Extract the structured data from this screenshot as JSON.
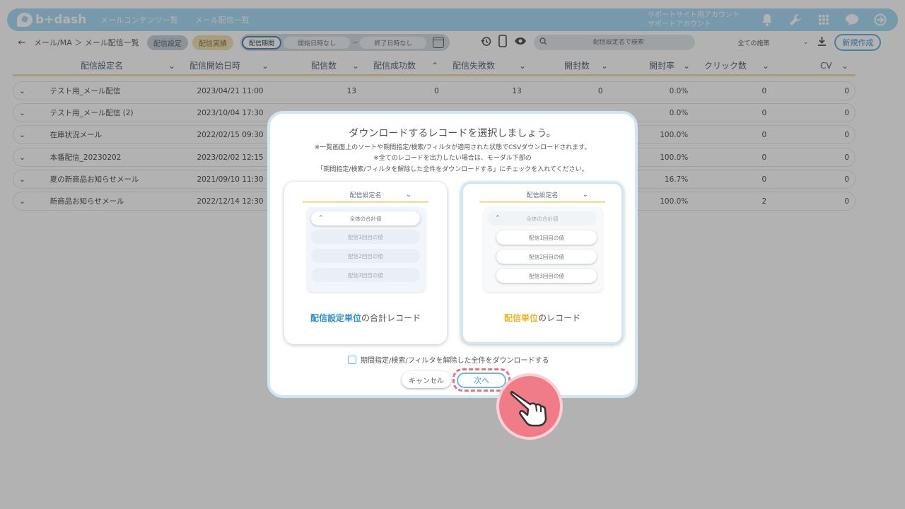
{
  "header": {
    "logo_text": "b+dash",
    "nav": [
      "メールコンテンツ一覧",
      "メール配信一覧"
    ],
    "account_line1": "サポートサイト用アカウント",
    "account_line2": "サポートアカウント"
  },
  "toolbar": {
    "back": "←",
    "breadcrumb": "メール/MA ＞ メール配信一覧",
    "chip_settings": "配信設定",
    "chip_results": "配信実績",
    "period_label": "配信期間",
    "start_date": "開始日時なし",
    "tilde": "~",
    "end_date": "終了日時なし",
    "search_placeholder": "配信設定名で検索",
    "filter_value": "全ての施策",
    "new_button": "新規作成"
  },
  "table": {
    "headers": [
      "配信設定名",
      "配信開始日時",
      "配信数",
      "配信成功数",
      "配信失敗数",
      "開封数",
      "開封率",
      "クリック数",
      "CV"
    ],
    "rows": [
      {
        "name": "テスト用_メール配信",
        "date": "2023/04/21 11:00",
        "sent": "13",
        "success": "0",
        "fail": "13",
        "open": "0",
        "rate": "0.0%",
        "click": "0",
        "cv": "0"
      },
      {
        "name": "テスト用_メール配信 (2)",
        "date": "2023/10/04 17:30",
        "sent": "",
        "success": "",
        "fail": "",
        "open": "",
        "rate": "0.0%",
        "click": "0",
        "cv": "0"
      },
      {
        "name": "在庫状況メール",
        "date": "2022/02/15 09:30",
        "sent": "",
        "success": "",
        "fail": "",
        "open": "",
        "rate": "100.0%",
        "click": "0",
        "cv": "0"
      },
      {
        "name": "本番配信_20230202",
        "date": "2023/02/02 12:15",
        "sent": "",
        "success": "",
        "fail": "",
        "open": "",
        "rate": "100.0%",
        "click": "0",
        "cv": "0"
      },
      {
        "name": "夏の新商品お知らせメール",
        "date": "2021/09/10 11:30",
        "sent": "",
        "success": "",
        "fail": "",
        "open": "",
        "rate": "16.7%",
        "click": "0",
        "cv": "0"
      },
      {
        "name": "新商品お知らせメール",
        "date": "2022/12/14 12:30",
        "sent": "",
        "success": "",
        "fail": "",
        "open": "",
        "rate": "100.0%",
        "click": "2",
        "cv": "0"
      }
    ]
  },
  "modal": {
    "title": "ダウンロードするレコードを選択しましょう。",
    "note1": "※一覧画面上のソートや期間指定/検索/フィルタが適用された状態でCSVダウンロードされます。",
    "note2": "※全てのレコードを出力したい場合は、モーダル下部の",
    "note3": "「期間指定/検索/フィルタを解除した全件をダウンロードする」にチェックを入れてください。",
    "card_header": "配信設定名",
    "total_row": "全体の合計値",
    "sub_rows": [
      "配信1回目の値",
      "配信2回目の値",
      "配信3回目の値"
    ],
    "left_label_highlight": "配信設定単位",
    "left_label_rest": "の合計レコード",
    "right_label_highlight": "配信単位",
    "right_label_rest": "のレコード",
    "checkbox_label": "期間指定/検索/フィルタを解除した全件をダウンロードする",
    "cancel": "キャンセル",
    "next": "次へ"
  }
}
